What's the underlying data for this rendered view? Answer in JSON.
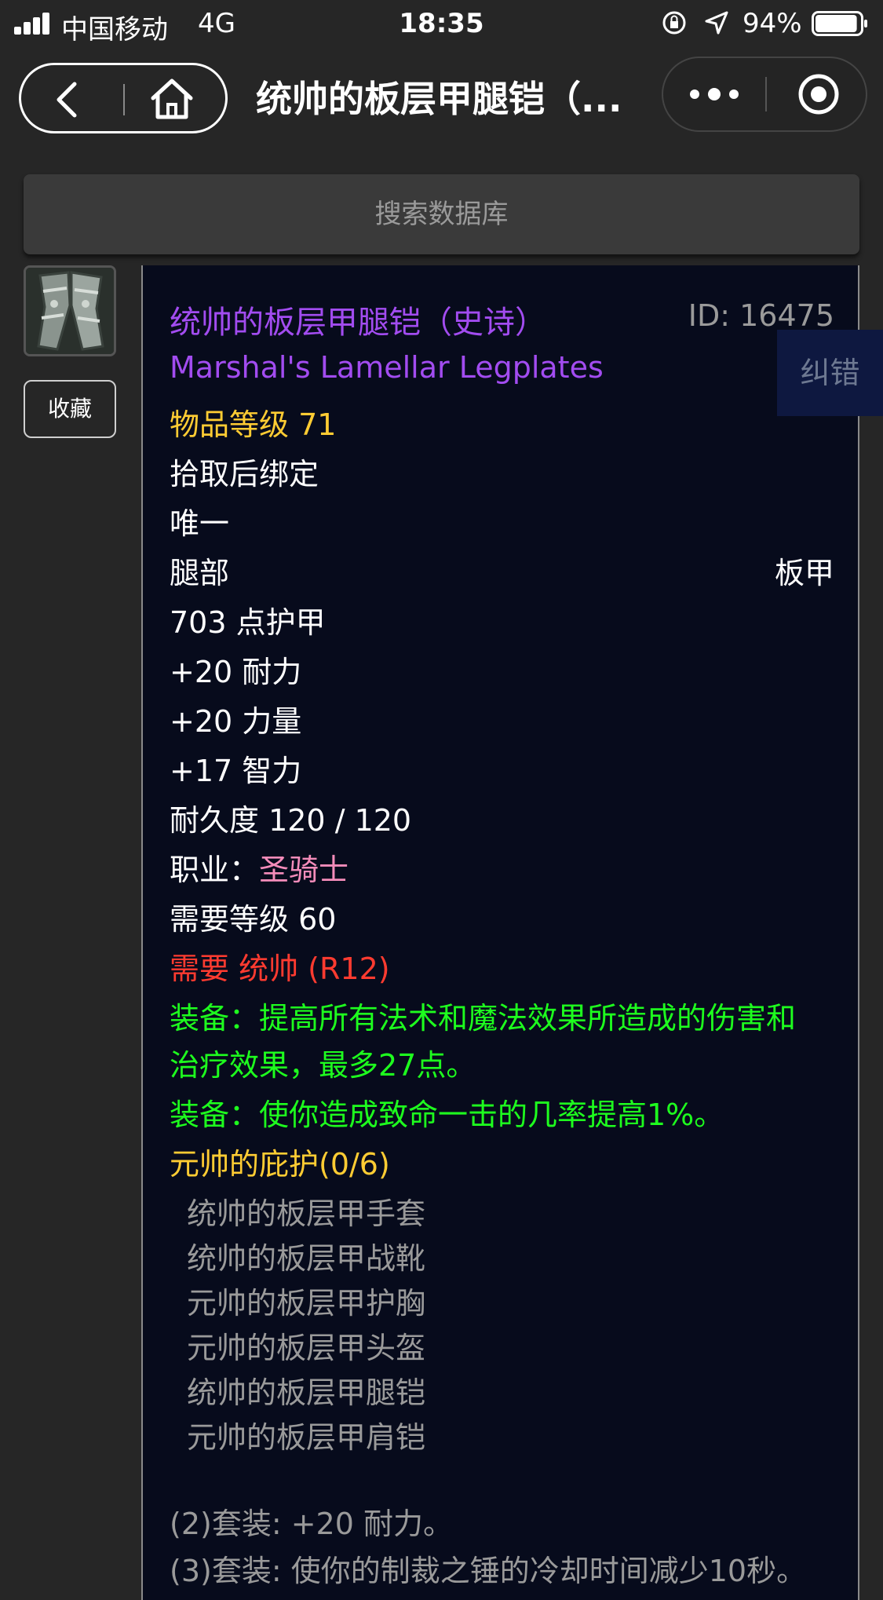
{
  "status_bar": {
    "carrier": "中国移动",
    "network": "4G",
    "time": "18:35",
    "battery": "94%",
    "battery_level": 0.94,
    "icons": [
      "signal-icon",
      "rotation-lock-icon",
      "location-arrow-icon",
      "battery-icon"
    ]
  },
  "nav": {
    "title": "统帅的板层甲腿铠（...",
    "icons": [
      "back-icon",
      "home-icon",
      "more-icon",
      "close-target-icon"
    ]
  },
  "search": {
    "placeholder": "搜索数据库"
  },
  "sidebar": {
    "favorite_label": "收藏",
    "item_icon": "legplates-icon"
  },
  "item": {
    "name_cn": "统帅的板层甲腿铠（史诗）",
    "id_label": "ID: 16475",
    "name_en": "Marshal's Lamellar Legplates",
    "report_label": "纠错",
    "item_level": "物品等级 71",
    "bind": "拾取后绑定",
    "unique": "唯一",
    "slot": "腿部",
    "armor_type": "板甲",
    "armor": "703 点护甲",
    "stats": [
      "+20 耐力",
      "+20 力量",
      "+17 智力"
    ],
    "durability": "耐久度 120 / 120",
    "class_prefix": "职业：",
    "class_name": "圣骑士",
    "req_level": "需要等级 60",
    "req_rank": "需要 统帅 (R12)",
    "equip_effects": [
      "装备：提高所有法术和魔法效果所造成的伤害和",
      "治疗效果，最多27点。",
      "装备：使你造成致命一击的几率提高1%。"
    ],
    "set_name": "元帅的庇护(0/6)",
    "set_items": [
      "统帅的板层甲手套",
      "统帅的板层甲战靴",
      "元帅的板层甲护胸",
      "元帅的板层甲头盔",
      "统帅的板层甲腿铠",
      "元帅的板层甲肩铠"
    ],
    "set_bonuses": [
      "(2)套装: +20 耐力。",
      "(3)套装: 使你的制裁之锤的冷却时间减少10秒。"
    ]
  },
  "colors": {
    "epic": "#a24cf0",
    "item_level": "#ffcc33",
    "requirement": "#ff3b30",
    "class": "#f48cba",
    "equip": "#1eff1e",
    "set_item": "#9a9a9a",
    "panel_bg": "#070b1c",
    "page_bg": "#262626"
  }
}
